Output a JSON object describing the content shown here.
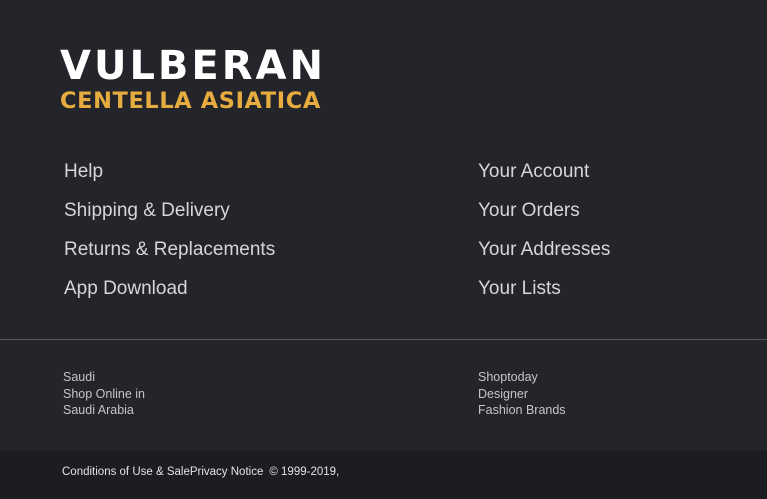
{
  "brand": {
    "title": "VULBERAN",
    "subtitle": "CENTELLA ASIATICA"
  },
  "help_links": [
    {
      "label": "Help"
    },
    {
      "label": "Shipping & Delivery"
    },
    {
      "label": "Returns & Replacements"
    },
    {
      "label": "App Download"
    }
  ],
  "account_links": [
    {
      "label": "Your Account"
    },
    {
      "label": "Your Orders"
    },
    {
      "label": "Your Addresses"
    },
    {
      "label": "Your Lists"
    }
  ],
  "region": {
    "line1": "Saudi",
    "line2": "Shop Online in",
    "line3": "Saudi Arabia"
  },
  "promo": {
    "line1": "Shoptoday",
    "line2": "Designer",
    "line3": "Fashion Brands"
  },
  "legal": {
    "conditions": "Conditions of Use & Sale",
    "privacy": "Privacy Notice",
    "copyright": "© 1999-2019,"
  },
  "colors": {
    "background": "#24252a",
    "bottom_bar": "#1c1d21",
    "brand_accent": "#e7ac3f",
    "link_text": "#d5d6d9"
  }
}
